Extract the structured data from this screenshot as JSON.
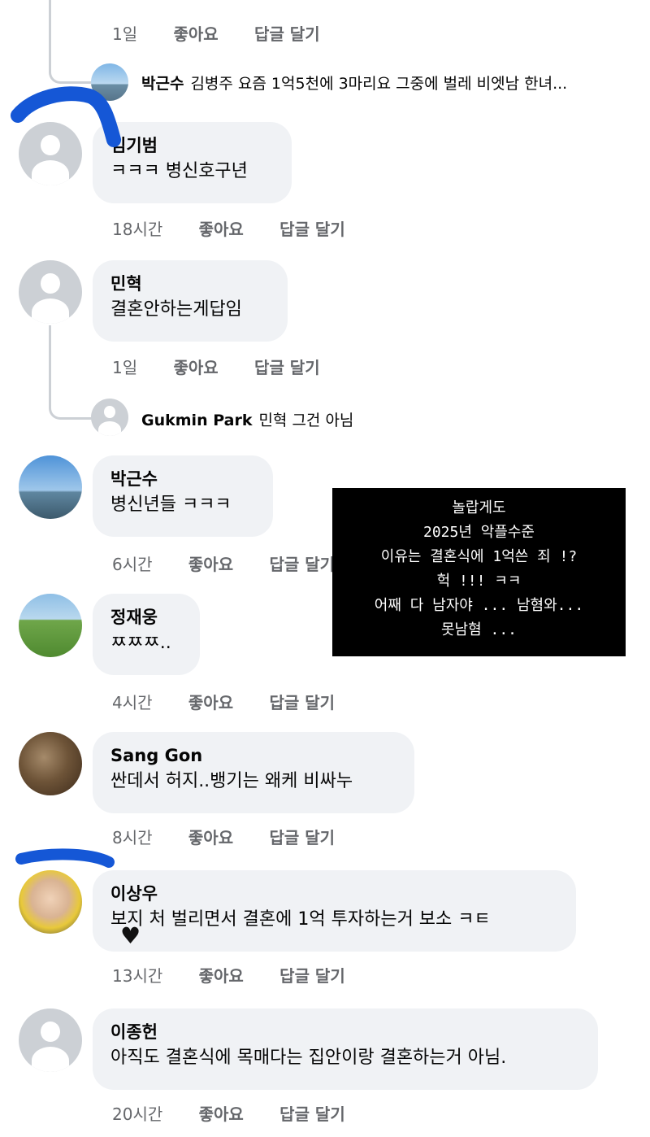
{
  "top_meta": {
    "time": "1일",
    "like": "좋아요",
    "reply": "답글 달기"
  },
  "top_reply": {
    "author": "박근수",
    "text": "김병주 요즘 1억5천에 3마리요 그중에 벌레 비엣남 한녀..."
  },
  "comments": [
    {
      "author": "김기범",
      "text": "ㅋㅋㅋ 병신호구년",
      "time": "18시간",
      "like": "좋아요",
      "reply": "답글 달기",
      "avatar": "default-avatar"
    },
    {
      "author": "민혁",
      "text": "결혼안하는게답임",
      "time": "1일",
      "like": "좋아요",
      "reply": "답글 달기",
      "avatar": "default-avatar"
    },
    {
      "author": "박근수",
      "text": "병신년들 ㅋㅋㅋ",
      "time": "6시간",
      "like": "좋아요",
      "reply": "답글 달기",
      "avatar": "landscape-photo-avatar"
    },
    {
      "author": "정재웅",
      "text": "ㅉㅉㅉ..",
      "time": "4시간",
      "like": "좋아요",
      "reply": "답글 달기",
      "avatar": "park-photo-avatar"
    },
    {
      "author": "Sang Gon",
      "text": "싼데서 허지..뱅기는 왜케 비싸누",
      "time": "8시간",
      "like": "좋아요",
      "reply": "답글 달기",
      "avatar": "cat-photo-avatar"
    },
    {
      "author": "이상우",
      "text": "보지 처 벌리면서 결혼에 1억 투자하는거 보소 ㅋㅌ",
      "time": "13시간",
      "like": "좋아요",
      "reply": "답글 달기",
      "avatar": "person-photo-avatar"
    },
    {
      "author": "이종헌",
      "text": "아직도 결혼식에 목매다는 집안이랑 결혼하는거 아님.",
      "time": "20시간",
      "like": "좋아요",
      "reply": "답글 달기",
      "avatar": "default-avatar"
    }
  ],
  "minhyuk_reply": {
    "author": "Gukmin Park",
    "text": "민혁 그건 아님"
  },
  "overlay_lines": [
    "놀랍게도",
    "2025년 악플수준",
    "이유는 결혼식에 1억쓴 죄 !?",
    "헉 !!! ㅋㅋ",
    "어째 다 남자야 ... 남혐와...",
    "못남혐 ..."
  ],
  "colors": {
    "bubble": "#f0f2f5",
    "meta": "#65676b",
    "scribble": "#1557d6",
    "overlay": "#000000"
  }
}
